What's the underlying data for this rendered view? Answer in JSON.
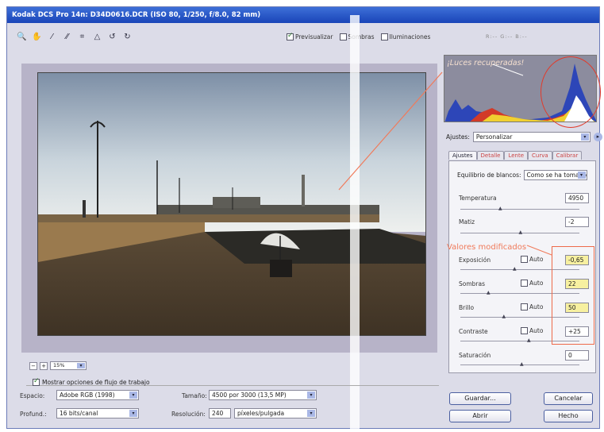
{
  "window": {
    "title": "Kodak DCS Pro 14n:  D34D0616.DCR  (ISO 80, 1/250, f/8.0, 82 mm)"
  },
  "toolbar": {
    "tools": [
      "zoom-icon",
      "hand-icon",
      "eyedropper-icon",
      "color-sampler-icon",
      "crop-icon",
      "straighten-icon",
      "rotate-left-icon",
      "rotate-right-icon"
    ],
    "glyphs": [
      "🔍",
      "✋",
      "⁄",
      "⁄⁄",
      "⌗",
      "△",
      "↺",
      "↻"
    ]
  },
  "view_options": {
    "preview": {
      "label": "Previsualizar",
      "checked": true
    },
    "shadows": {
      "label": "Sombras",
      "checked": false
    },
    "highlights": {
      "label": "Iluminaciones",
      "checked": false
    }
  },
  "rgb_readout": "R:--  G:--  B:--",
  "histogram": {
    "annotation": "¡Luces recuperadas!"
  },
  "settings": {
    "label": "Ajustes:",
    "value": "Personalizar",
    "arrow": "▾",
    "menu": "▸"
  },
  "tabs": [
    {
      "label": "Ajustes",
      "active": true
    },
    {
      "label": "Detalle",
      "active": false
    },
    {
      "label": "Lente",
      "active": false
    },
    {
      "label": "Curva",
      "active": false
    },
    {
      "label": "Calibrar",
      "active": false
    }
  ],
  "white_balance": {
    "label": "Equilibrio de blancos:",
    "value": "Como se ha tomado"
  },
  "adjustments": {
    "temperature": {
      "label": "Temperatura",
      "value": "4950",
      "level": 0.32
    },
    "tint": {
      "label": "Matiz",
      "value": "-2",
      "level": 0.49
    },
    "annotation": "Valores modificados",
    "exposure": {
      "label": "Exposición",
      "value": "-0,65",
      "auto_label": "Auto",
      "auto": false,
      "level": 0.44
    },
    "shadows": {
      "label": "Sombras",
      "value": "22",
      "auto_label": "Auto",
      "auto": false,
      "level": 0.22
    },
    "brightness": {
      "label": "Brillo",
      "value": "50",
      "auto_label": "Auto",
      "auto": false,
      "level": 0.35
    },
    "contrast": {
      "label": "Contraste",
      "value": "+25",
      "auto_label": "Auto",
      "auto": false,
      "level": 0.56
    },
    "saturation": {
      "label": "Saturación",
      "value": "0",
      "level": 0.5
    }
  },
  "zoom": {
    "minus": "−",
    "plus": "+",
    "value": "15%"
  },
  "workflow": {
    "show_label": "Mostrar opciones de flujo de trabajo",
    "show_checked": true,
    "space_label": "Espacio:",
    "space_value": "Adobe RGB (1998)",
    "depth_label": "Profund.:",
    "depth_value": "16 bits/canal",
    "size_label": "Tamaño:",
    "size_value": "4500 por 3000  (13,5 MP)",
    "resolution_label": "Resolución:",
    "resolution_value": "240",
    "resolution_unit": "píxeles/pulgada"
  },
  "buttons": {
    "save": "Guardar...",
    "cancel": "Cancelar",
    "open": "Abrir",
    "done": "Hecho"
  },
  "colors": {
    "title_bar": "#1a45b8",
    "annotation": "#f07a5a",
    "highlight_field": "#f7f0a0"
  }
}
